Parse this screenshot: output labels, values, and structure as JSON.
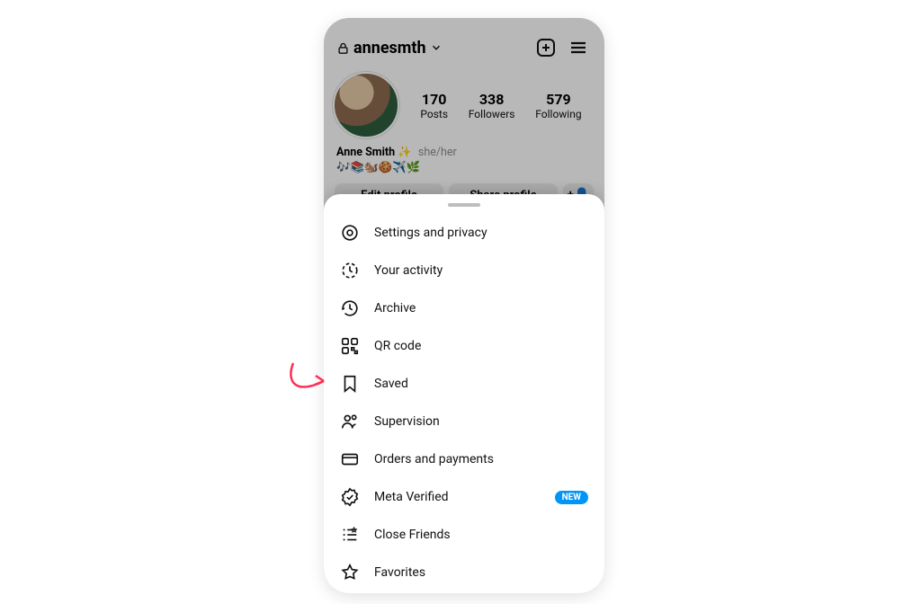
{
  "header": {
    "username": "annesmth"
  },
  "stats": {
    "posts_num": "170",
    "posts_label": "Posts",
    "followers_num": "338",
    "followers_label": "Followers",
    "following_num": "579",
    "following_label": "Following"
  },
  "bio": {
    "display_name": "Anne Smith ✨",
    "pronouns": "she/her",
    "line2": "🎶📚🐿️🍪✈️🌿"
  },
  "actions": {
    "edit": "Edit profile",
    "share": "Share profile",
    "add": "+👤"
  },
  "menu": {
    "items": [
      {
        "label": "Settings and privacy"
      },
      {
        "label": "Your activity"
      },
      {
        "label": "Archive"
      },
      {
        "label": "QR code"
      },
      {
        "label": "Saved"
      },
      {
        "label": "Supervision"
      },
      {
        "label": "Orders and payments"
      },
      {
        "label": "Meta Verified",
        "badge": "NEW"
      },
      {
        "label": "Close Friends"
      },
      {
        "label": "Favorites"
      }
    ]
  }
}
